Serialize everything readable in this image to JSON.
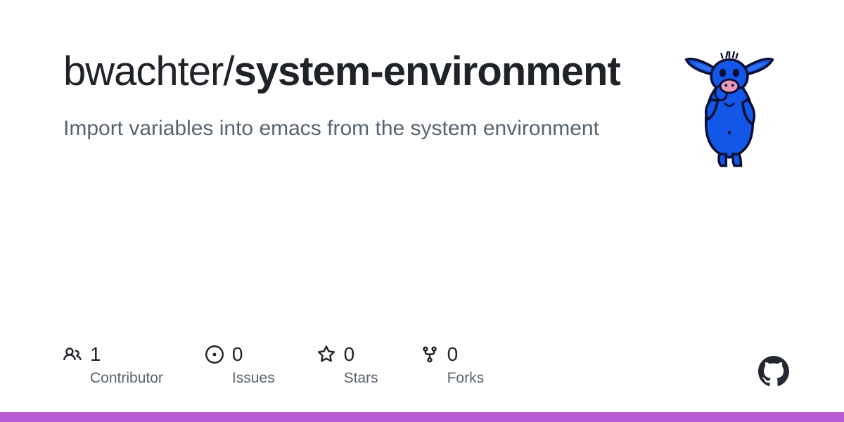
{
  "repo": {
    "owner": "bwachter",
    "separator": "/",
    "name": "system-environment",
    "description": "Import variables into emacs from the system environment"
  },
  "stats": {
    "contributors": {
      "value": "1",
      "label": "Contributor"
    },
    "issues": {
      "value": "0",
      "label": "Issues"
    },
    "stars": {
      "value": "0",
      "label": "Stars"
    },
    "forks": {
      "value": "0",
      "label": "Forks"
    }
  },
  "colors": {
    "language_bar": "#b75dd4"
  }
}
